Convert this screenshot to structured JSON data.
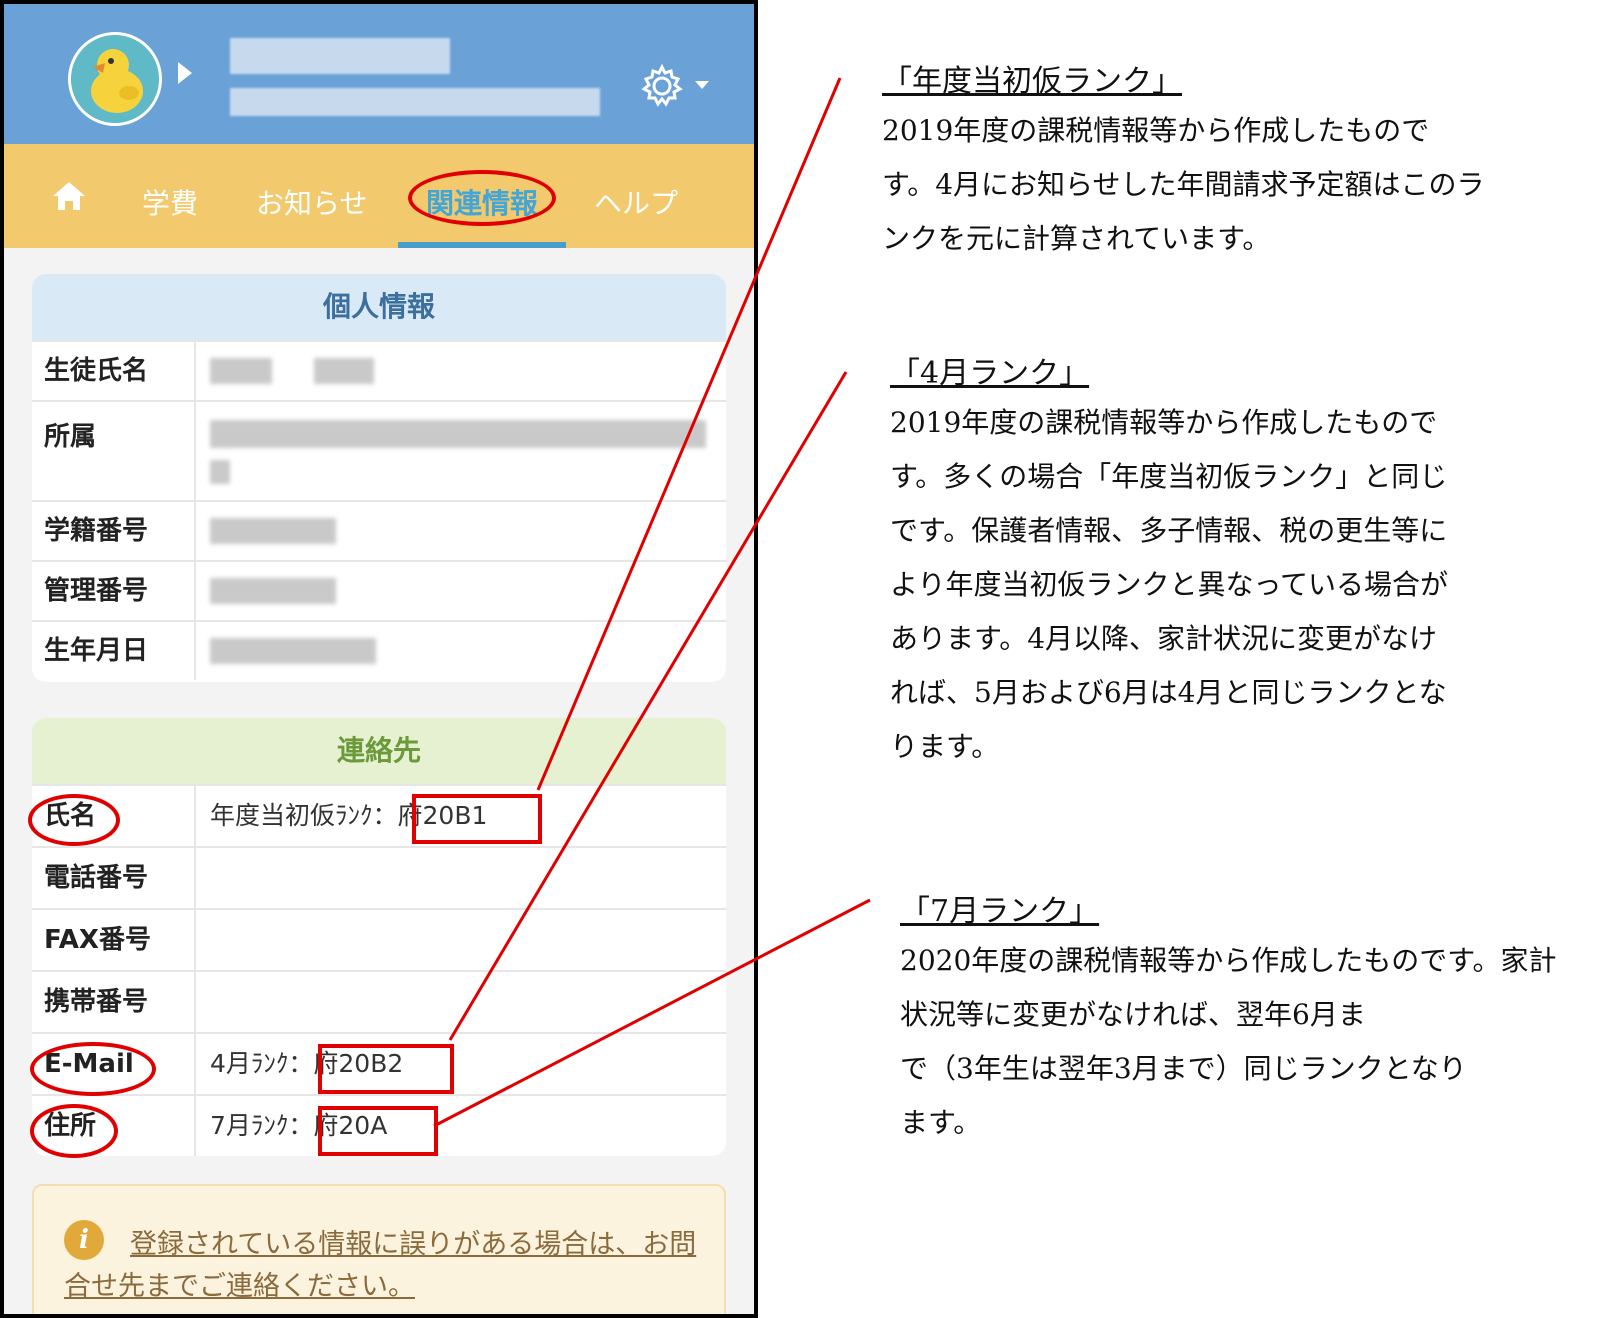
{
  "nav": {
    "items": [
      "学費",
      "お知らせ",
      "関連情報",
      "ヘルプ"
    ],
    "active": "関連情報"
  },
  "personal": {
    "title": "個人情報",
    "labels": [
      "生徒氏名",
      "所属",
      "学籍番号",
      "管理番号",
      "生年月日"
    ]
  },
  "contact": {
    "title": "連絡先",
    "rows": [
      {
        "label": "氏名",
        "prefix": "年度当初仮ﾗﾝｸ：",
        "rank": "府20B1"
      },
      {
        "label": "電話番号",
        "prefix": "",
        "rank": ""
      },
      {
        "label": "FAX番号",
        "prefix": "",
        "rank": ""
      },
      {
        "label": "携帯番号",
        "prefix": "",
        "rank": ""
      },
      {
        "label": "E-Mail",
        "prefix": "4月ﾗﾝｸ：",
        "rank": "府20B2"
      },
      {
        "label": "住所",
        "prefix": "7月ﾗﾝｸ：",
        "rank": "府20A"
      }
    ]
  },
  "notice": {
    "text": "登録されている情報に誤りがある場合は、お問合せ先までご連絡ください。"
  },
  "annotations": [
    {
      "title": "「年度当初仮ランク」",
      "lines": [
        "2019年度の課税情報等から作成したもので",
        "す。4月にお知らせした年間請求予定額はこのラ",
        "ンクを元に計算されています。"
      ]
    },
    {
      "title": "「4月ランク」",
      "lines": [
        "2019年度の課税情報等から作成したもので",
        "す。多くの場合「年度当初仮ランク」と同じ",
        "です。保護者情報、多子情報、税の更生等に",
        "より年度当初仮ランクと異なっている場合が",
        "あります。4月以降、家計状況に変更がなけ",
        "れば、5月および6月は4月と同じランクとな",
        "ります。"
      ]
    },
    {
      "title": "「7月ランク」",
      "lines": [
        "2020年度の課税情報等から作成したものです。家計状況等に変更がなければ、翌年6月ま",
        "で（3年生は翌年3月まで）同じランクとなり",
        "ます。"
      ]
    }
  ],
  "colors": {
    "header_blue": "#6aa2d8",
    "nav_yellow": "#f2c96c",
    "accent": "#e00000"
  }
}
